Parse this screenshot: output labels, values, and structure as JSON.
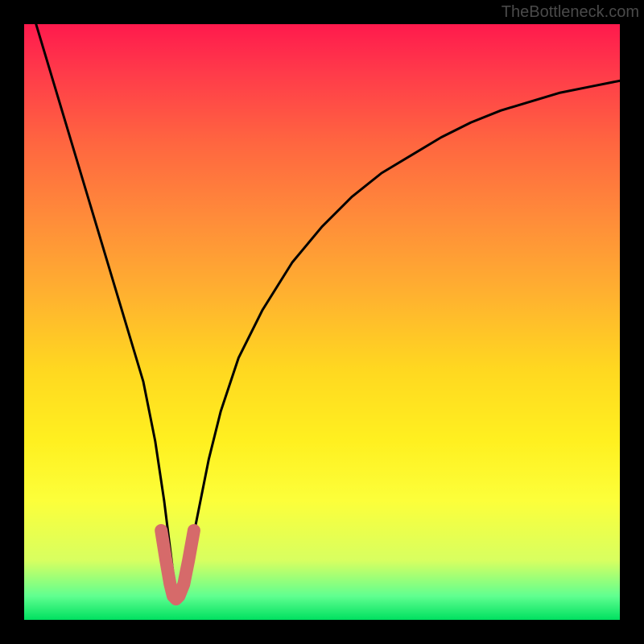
{
  "attribution": "TheBottleneck.com",
  "chart_data": {
    "type": "line",
    "title": "",
    "xlabel": "",
    "ylabel": "",
    "xlim": [
      0,
      100
    ],
    "ylim": [
      0,
      100
    ],
    "series": [
      {
        "name": "curve-black",
        "color": "#000000",
        "x": [
          2,
          5,
          8,
          11,
          14,
          17,
          20,
          22,
          23.5,
          24.5,
          25,
          25.5,
          26,
          27,
          28,
          29,
          30,
          31,
          33,
          36,
          40,
          45,
          50,
          55,
          60,
          65,
          70,
          75,
          80,
          85,
          90,
          95,
          100
        ],
        "values": [
          100,
          90,
          80,
          70,
          60,
          50,
          40,
          30,
          20,
          12,
          8,
          5,
          5,
          8,
          12,
          17,
          22,
          27,
          35,
          44,
          52,
          60,
          66,
          71,
          75,
          78,
          81,
          83.5,
          85.5,
          87,
          88.5,
          89.5,
          90.5
        ]
      },
      {
        "name": "minimum-highlight",
        "color": "#d66a6a",
        "x": [
          23,
          23.8,
          24.5,
          25,
          25.5,
          26,
          26.8,
          27.6,
          28.5
        ],
        "values": [
          15,
          10,
          6,
          4,
          3.5,
          4,
          6,
          10,
          15
        ]
      }
    ],
    "grid": false,
    "legend": false
  }
}
